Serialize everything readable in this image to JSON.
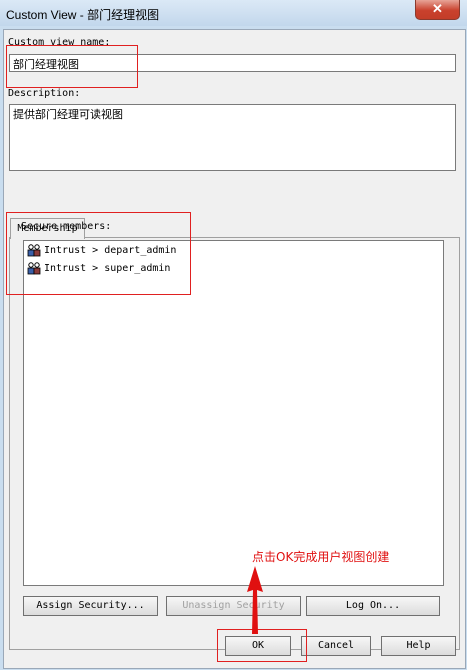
{
  "window": {
    "title": "Custom View - 部门经理视图",
    "close_glyph": "✕"
  },
  "form": {
    "name_label": "Custom view name:",
    "name_value": "部门经理视图",
    "description_label": "Description:",
    "description_value": "提供部门经理可读视图"
  },
  "tabs": [
    {
      "label": "Membership",
      "selected": true
    }
  ],
  "membership": {
    "secure_members_label": "Secure members:",
    "members": [
      {
        "label": "Intrust > depart_admin",
        "icon": "user-group-icon"
      },
      {
        "label": "Intrust > super_admin",
        "icon": "user-group-icon"
      }
    ],
    "assign_label": "Assign Security...",
    "unassign_label": "Unassign Security",
    "unassign_enabled": false,
    "logon_label": "Log On..."
  },
  "buttons": {
    "ok": "OK",
    "cancel": "Cancel",
    "help": "Help"
  },
  "annotation": {
    "text": "点击OK完成用户视图创建",
    "color": "#e01010"
  }
}
